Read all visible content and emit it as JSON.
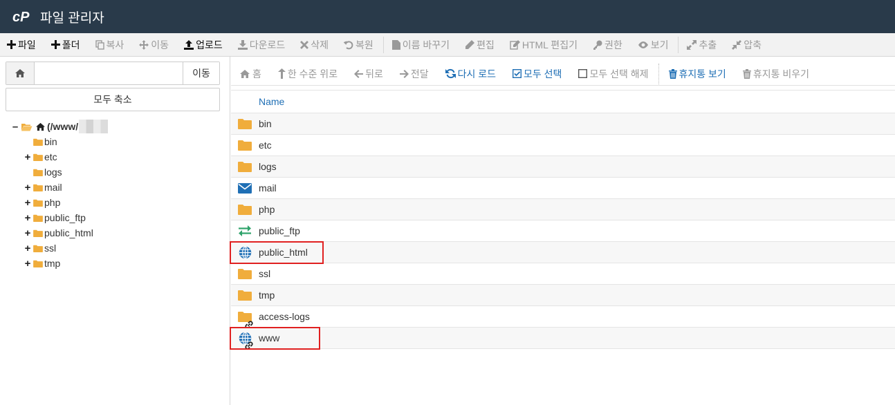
{
  "app": {
    "title": "파일 관리자"
  },
  "toolbar": [
    {
      "label": "파일",
      "icon": "plus-icon",
      "active": true
    },
    {
      "label": "폴더",
      "icon": "plus-icon",
      "active": true
    },
    {
      "label": "복사",
      "icon": "copy-icon",
      "active": false
    },
    {
      "label": "이동",
      "icon": "move-icon",
      "active": false
    },
    {
      "label": "업로드",
      "icon": "upload-icon",
      "active": true
    },
    {
      "label": "다운로드",
      "icon": "download-icon",
      "active": false
    },
    {
      "label": "삭제",
      "icon": "close-icon",
      "active": false
    },
    {
      "label": "복원",
      "icon": "undo-icon",
      "active": false
    },
    {
      "label": "이름 바꾸기",
      "icon": "file-icon",
      "active": false
    },
    {
      "label": "편집",
      "icon": "pencil-icon",
      "active": false
    },
    {
      "label": "HTML 편집기",
      "icon": "edit-icon",
      "active": false
    },
    {
      "label": "권한",
      "icon": "key-icon",
      "active": false
    },
    {
      "label": "보기",
      "icon": "eye-icon",
      "active": false
    },
    {
      "label": "추출",
      "icon": "expand-icon",
      "active": false
    },
    {
      "label": "압축",
      "icon": "compress-icon",
      "active": false
    }
  ],
  "path_bar": {
    "value": "",
    "go_label": "이동"
  },
  "collapse_label": "모두 축소",
  "tree": {
    "root_label": "(/www/",
    "items": [
      {
        "label": "bin",
        "expandable": false
      },
      {
        "label": "etc",
        "expandable": true
      },
      {
        "label": "logs",
        "expandable": false
      },
      {
        "label": "mail",
        "expandable": true
      },
      {
        "label": "php",
        "expandable": true
      },
      {
        "label": "public_ftp",
        "expandable": true
      },
      {
        "label": "public_html",
        "expandable": true
      },
      {
        "label": "ssl",
        "expandable": true
      },
      {
        "label": "tmp",
        "expandable": true
      }
    ]
  },
  "nav": [
    {
      "label": "홈",
      "icon": "home-icon",
      "color": "gray"
    },
    {
      "label": "한 수준 위로",
      "icon": "level-up-icon",
      "color": "gray"
    },
    {
      "label": "뒤로",
      "icon": "arrow-left-icon",
      "color": "gray"
    },
    {
      "label": "전달",
      "icon": "arrow-right-icon",
      "color": "gray"
    },
    {
      "label": "다시 로드",
      "icon": "refresh-icon",
      "color": "blue"
    },
    {
      "label": "모두 선택",
      "icon": "checkbox-checked-icon",
      "color": "blue"
    },
    {
      "label": "모두 선택 해제",
      "icon": "checkbox-icon",
      "color": "gray"
    },
    {
      "label": "휴지통 보기",
      "icon": "trash-icon",
      "color": "blue"
    },
    {
      "label": "휴지통 비우기",
      "icon": "trash-icon",
      "color": "gray"
    }
  ],
  "table": {
    "header": "Name",
    "rows": [
      {
        "name": "bin",
        "icon": "folder-icon"
      },
      {
        "name": "etc",
        "icon": "folder-icon"
      },
      {
        "name": "logs",
        "icon": "folder-icon"
      },
      {
        "name": "mail",
        "icon": "mail-icon"
      },
      {
        "name": "php",
        "icon": "folder-icon"
      },
      {
        "name": "public_ftp",
        "icon": "transfer-icon"
      },
      {
        "name": "public_html",
        "icon": "globe-icon",
        "highlight": true
      },
      {
        "name": "ssl",
        "icon": "folder-icon"
      },
      {
        "name": "tmp",
        "icon": "folder-icon"
      },
      {
        "name": "access-logs",
        "icon": "folder-link-icon"
      },
      {
        "name": "www",
        "icon": "globe-link-icon",
        "highlight": true
      }
    ]
  },
  "colors": {
    "header_bg": "#293a4a",
    "link_blue": "#1f6fb5",
    "folder": "#f0ad3c",
    "highlight": "#e02020"
  }
}
